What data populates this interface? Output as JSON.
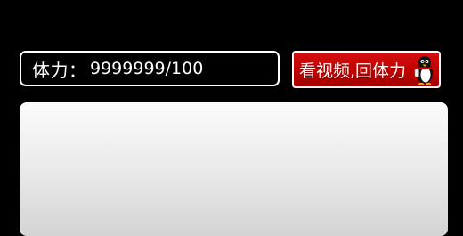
{
  "stamina": {
    "label": "体力",
    "separator": "：",
    "value": "9999999/100"
  },
  "video_button": {
    "label": "看视频,回体力",
    "icon": "penguin-icon"
  },
  "colors": {
    "background": "#000000",
    "button_red": "#c00000",
    "panel": "#eeeeee",
    "border": "#ffffff"
  }
}
